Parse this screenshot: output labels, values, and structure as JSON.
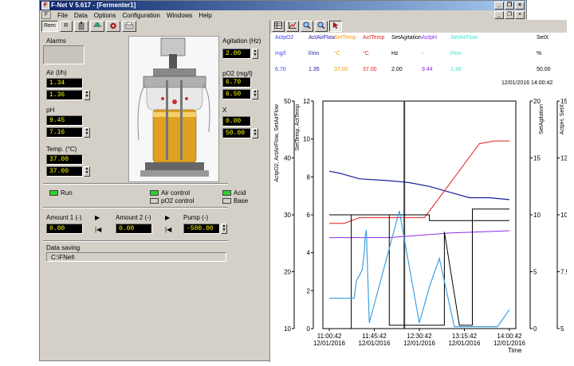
{
  "window": {
    "title": "F-Net V 5.617 - [Fermenter1]",
    "app_icon": "fnet-app-icon",
    "controls": [
      "_",
      "❐",
      "×"
    ],
    "mdi_controls": [
      "_",
      "❐",
      "×"
    ]
  },
  "menu": [
    "File",
    "Data",
    "Options",
    "Configuration",
    "Windows",
    "Help"
  ],
  "toolbar": {
    "buttons": [
      "Rem",
      "R"
    ],
    "icons": [
      "fermenter-icon",
      "valve-icon",
      "settings-icon",
      "printer-icon"
    ]
  },
  "chart_toolbar": {
    "icons": [
      "table-icon",
      "chart-icon",
      "zoom-in-icon",
      "zoom-out-icon",
      "cursor-icon"
    ]
  },
  "panel": {
    "alarms_label": "Alarms",
    "air_label": "Air (l/h)",
    "air_actual": "1.34",
    "air_set": "1.36",
    "ph_label": "pH",
    "ph_actual": "9.45",
    "ph_set": "7.16",
    "temp_label": "Temp. (°C)",
    "temp_actual": "37.00",
    "temp_set": "37.00",
    "agitation_label": "Agitation (Hz)",
    "agitation_value": "2.00",
    "po2_label": "pO2 (mg/l)",
    "po2_actual": "6.70",
    "po2_set": "6.50",
    "x_label": "X",
    "x_actual": "0.00",
    "x_set": "50.00",
    "run_label": "Run",
    "air_control_label": "Air control",
    "po2_control_label": "pO2 control",
    "acid_label": "Acid",
    "base_label": "Base",
    "amount1_label": "Amount 1 (-)",
    "amount1_value": "0.00",
    "amount2_label": "Amount 2 (-)",
    "amount2_value": "0.00",
    "pump_label": "Pump (-)",
    "pump_value": "-500.00",
    "data_saving_label": "Data saving",
    "data_saving_path": "C:\\FNet\\"
  },
  "header": {
    "columns": [
      {
        "name": "ActpO2",
        "unit": "mg/l",
        "value": "6.70",
        "color": "#4040ff"
      },
      {
        "name": "ActAirFlow",
        "unit": "l/mn",
        "value": "1.35",
        "color": "#1a1a9a"
      },
      {
        "name": "SetTemp",
        "unit": "°C",
        "value": "37.00",
        "color": "#ff9900"
      },
      {
        "name": "ActTemp",
        "unit": "°C",
        "value": "37.00",
        "color": "#e02020"
      },
      {
        "name": "SetAgitation",
        "unit": "Hz",
        "value": "2.00",
        "color": "#000000"
      },
      {
        "name": "ActpH",
        "unit": "-",
        "value": "9.44",
        "color": "#8a2be2"
      },
      {
        "name": "SetAirFlow",
        "unit": "l/mn",
        "value": "1.36",
        "color": "#40e0d0"
      },
      {
        "name": "SetX",
        "unit": "%",
        "value": "50.00",
        "color": "#000000"
      }
    ],
    "timestamp": "12/01/2016    14:00:42"
  },
  "chart_data": {
    "type": "line",
    "x_ticks": [
      {
        "time": "11:00:42",
        "date": "12/01/2016"
      },
      {
        "time": "11:45:42",
        "date": "12/01/2016"
      },
      {
        "time": "12:30:42",
        "date": "12/01/2016"
      },
      {
        "time": "13:15:42",
        "date": "12/01/2016"
      },
      {
        "time": "14:00:42",
        "date": "12/01/2016"
      }
    ],
    "x_label": "Time",
    "xlim": [
      "11:00:42",
      "14:00:42"
    ],
    "axes": [
      {
        "label": "ActpO2, ActAirFlow, SetAirFlow",
        "ticks": [
          "0",
          "2",
          "4",
          "6",
          "8",
          "10",
          "12"
        ],
        "ylim": [
          0,
          12
        ]
      },
      {
        "label": "SetTemp, ActTemp",
        "ticks": [
          "10",
          "20",
          "30",
          "40",
          "50"
        ],
        "ylim": [
          10,
          50
        ]
      },
      {
        "label": "SetAgitation",
        "ticks": [
          "0",
          "5",
          "10",
          "15",
          "20"
        ],
        "ylim": [
          0,
          20
        ]
      },
      {
        "label": "ActpH, SetX",
        "ticks": [
          "5",
          "7.5",
          "10",
          "12.5",
          "15"
        ],
        "ylim": [
          5,
          15
        ]
      }
    ],
    "cursor_time": "12:15:42",
    "series": [
      {
        "name": "ActAirFlow",
        "color": "#1a1a9a",
        "axis": 0,
        "points": [
          [
            0,
            8.3
          ],
          [
            10,
            8.2
          ],
          [
            30,
            7.9
          ],
          [
            60,
            7.8
          ],
          [
            80,
            7.7
          ],
          [
            100,
            7.5
          ],
          [
            120,
            7.2
          ],
          [
            140,
            6.9
          ],
          [
            160,
            6.9
          ],
          [
            180,
            6.8
          ]
        ]
      },
      {
        "name": "ActTemp",
        "color": "#e02020",
        "axis": 1,
        "points": [
          [
            0,
            28.5
          ],
          [
            15,
            28.5
          ],
          [
            30,
            29.5
          ],
          [
            80,
            29.5
          ],
          [
            95,
            29.5
          ],
          [
            110,
            33
          ],
          [
            150,
            42.5
          ],
          [
            165,
            43
          ],
          [
            180,
            43
          ]
        ]
      },
      {
        "name": "SetTemp",
        "color": "#000000",
        "axis": 1,
        "points": [
          [
            0,
            30
          ],
          [
            100,
            30
          ],
          [
            100,
            30
          ],
          [
            100,
            29
          ],
          [
            180,
            29
          ]
        ]
      },
      {
        "name": "ActpH",
        "color": "#8a2be2",
        "axis": 3,
        "points": [
          [
            0,
            9.0
          ],
          [
            60,
            9.0
          ],
          [
            120,
            9.2
          ],
          [
            180,
            9.3
          ]
        ]
      },
      {
        "name": "SetAgitation",
        "color": "#000000",
        "axis": 2,
        "points": [
          [
            0,
            0
          ],
          [
            22,
            0
          ],
          [
            22,
            10
          ],
          [
            30,
            10
          ],
          [
            30,
            10
          ],
          [
            60,
            10
          ],
          [
            60,
            0.3
          ],
          [
            90,
            0.3
          ],
          [
            90,
            0.3
          ],
          [
            95,
            0.3
          ],
          [
            95,
            0.3
          ],
          [
            115,
            0.3
          ],
          [
            115,
            8.5
          ],
          [
            130,
            0.3
          ],
          [
            138,
            0.3
          ],
          [
            143,
            0.3
          ],
          [
            143,
            10.5
          ],
          [
            180,
            10.5
          ]
        ]
      },
      {
        "name": "SetAirFlow",
        "color": "#40a0e0",
        "axis": 0,
        "points": [
          [
            0,
            1.6
          ],
          [
            25,
            1.6
          ],
          [
            27,
            2.5
          ],
          [
            30,
            2.8
          ],
          [
            33,
            3.1
          ],
          [
            35,
            4.0
          ],
          [
            36,
            4.9
          ],
          [
            37,
            5.2
          ],
          [
            40,
            0.3
          ],
          [
            70,
            6.2
          ],
          [
            90,
            0.3
          ],
          [
            100,
            2.2
          ],
          [
            110,
            3.7
          ],
          [
            125,
            0.1
          ],
          [
            150,
            0.1
          ],
          [
            168,
            0.1
          ],
          [
            180,
            1
          ]
        ]
      }
    ]
  }
}
